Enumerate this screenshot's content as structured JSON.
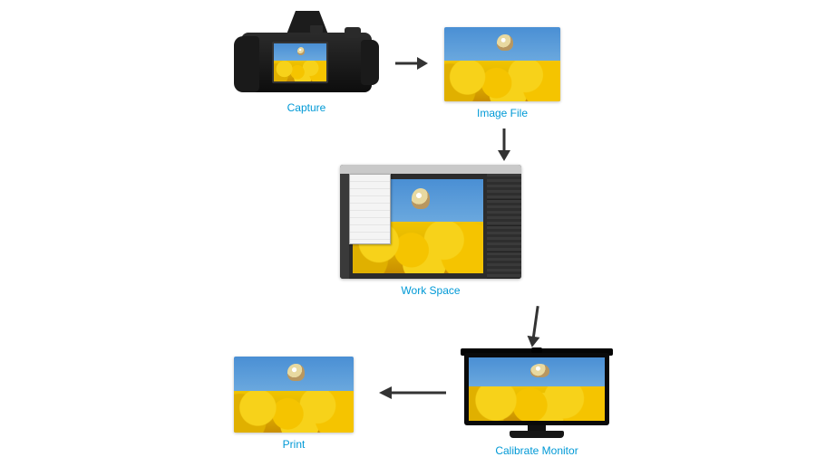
{
  "stages": {
    "capture": {
      "label": "Capture"
    },
    "image_file": {
      "label": "Image File"
    },
    "work_space": {
      "label": "Work Space"
    },
    "calibrate_monitor": {
      "label": "Calibrate Monitor"
    },
    "print": {
      "label": "Print"
    }
  },
  "flow": [
    {
      "from": "capture",
      "to": "image_file",
      "direction": "right"
    },
    {
      "from": "image_file",
      "to": "work_space",
      "direction": "down"
    },
    {
      "from": "work_space",
      "to": "calibrate_monitor",
      "direction": "down"
    },
    {
      "from": "calibrate_monitor",
      "to": "print",
      "direction": "left"
    }
  ],
  "colors": {
    "label": "#0099d6",
    "arrow": "#333333"
  }
}
